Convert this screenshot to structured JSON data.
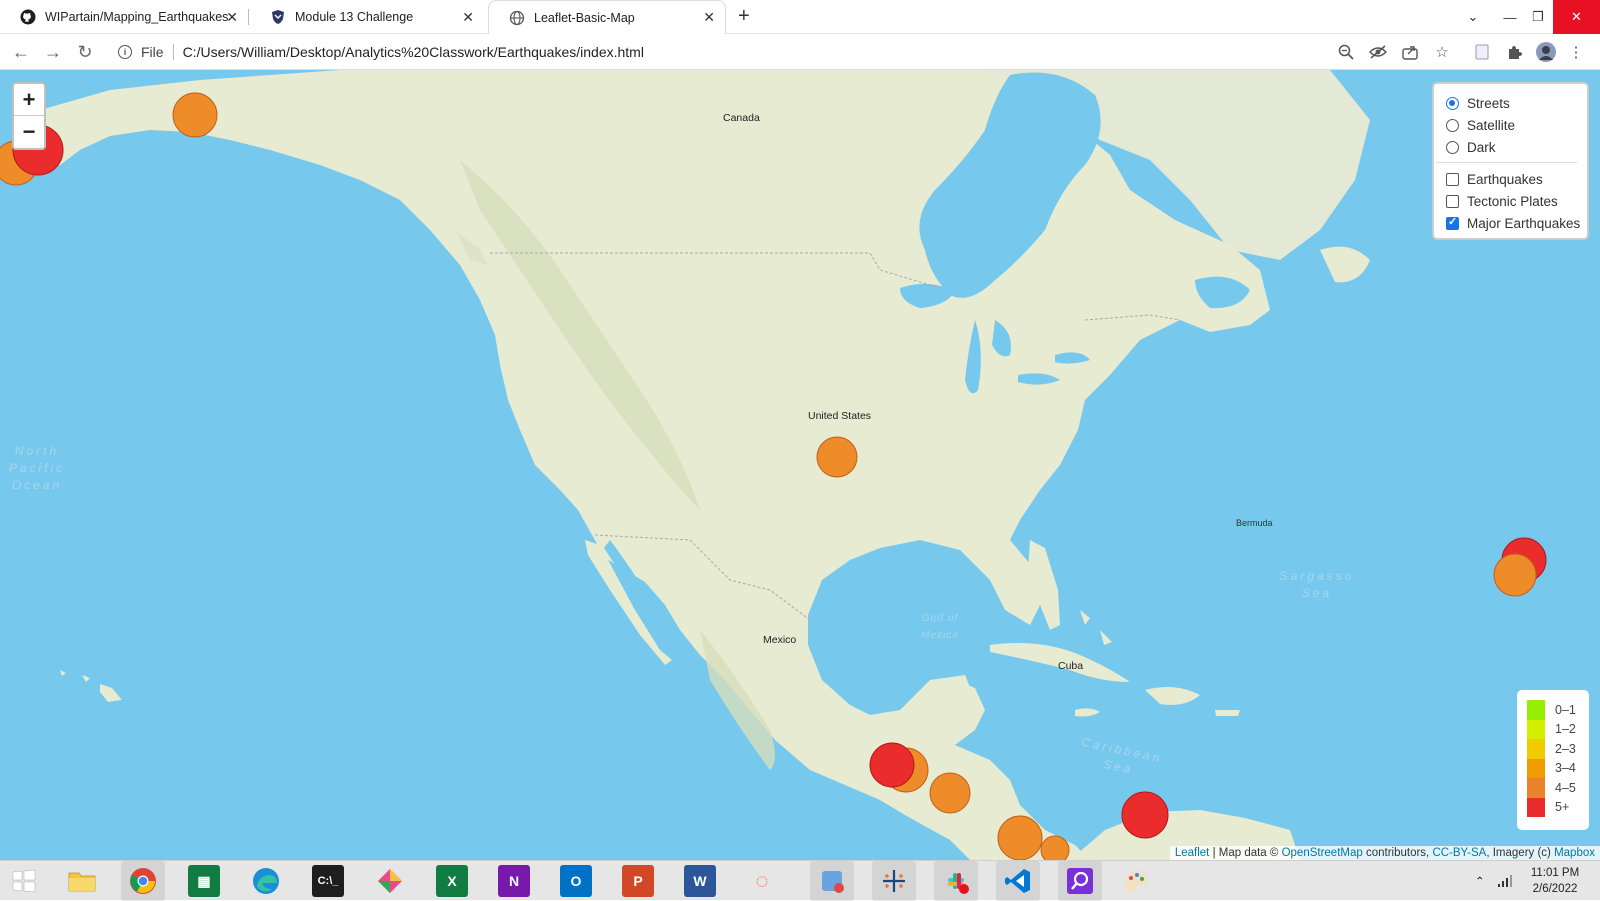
{
  "browser": {
    "tabs": [
      {
        "title": "WIPartain/Mapping_Earthquakes",
        "favicon": "github-icon"
      },
      {
        "title": "Module 13 Challenge",
        "favicon": "shield-icon"
      },
      {
        "title": "Leaflet-Basic-Map",
        "favicon": "globe-icon"
      }
    ],
    "address": {
      "scheme": "File",
      "url": "C:/Users/William/Desktop/Analytics%20Classwork/Earthquakes/index.html"
    }
  },
  "map": {
    "zoom_in_label": "+",
    "zoom_out_label": "−",
    "layer_control": {
      "base_layers": [
        {
          "label": "Streets",
          "selected": true
        },
        {
          "label": "Satellite",
          "selected": false
        },
        {
          "label": "Dark",
          "selected": false
        }
      ],
      "overlays": [
        {
          "label": "Earthquakes",
          "checked": false
        },
        {
          "label": "Tectonic Plates",
          "checked": false
        },
        {
          "label": "Major Earthquakes",
          "checked": true
        }
      ]
    },
    "legend": [
      {
        "label": "0–1",
        "color": "#98ee00"
      },
      {
        "label": "1–2",
        "color": "#d4ee00"
      },
      {
        "label": "2–3",
        "color": "#eecc00"
      },
      {
        "label": "3–4",
        "color": "#ee9c00"
      },
      {
        "label": "4–5",
        "color": "#ea822c"
      },
      {
        "label": "5+",
        "color": "#ea2c2c"
      }
    ],
    "attribution": {
      "leaflet": "Leaflet",
      "map_data": " | Map data © ",
      "osm": "OpenStreetMap",
      "contributors": " contributors, ",
      "license": "CC-BY-SA",
      "imagery": ", Imagery (c) ",
      "mapbox": "Mapbox"
    },
    "labels": {
      "north_pacific": "North\nPacific\nOcean",
      "canada": "Canada",
      "us": "United States",
      "mexico": "Mexico",
      "cuba": "Cuba",
      "caribbean": "Caribbean Sea",
      "sargasso": "Sargasso\nSea",
      "gulf": "Gulf of\nMexico",
      "bermuda": "Bermuda"
    }
  },
  "taskbar": {
    "time": "11:01 PM",
    "date": "2/6/2022"
  }
}
